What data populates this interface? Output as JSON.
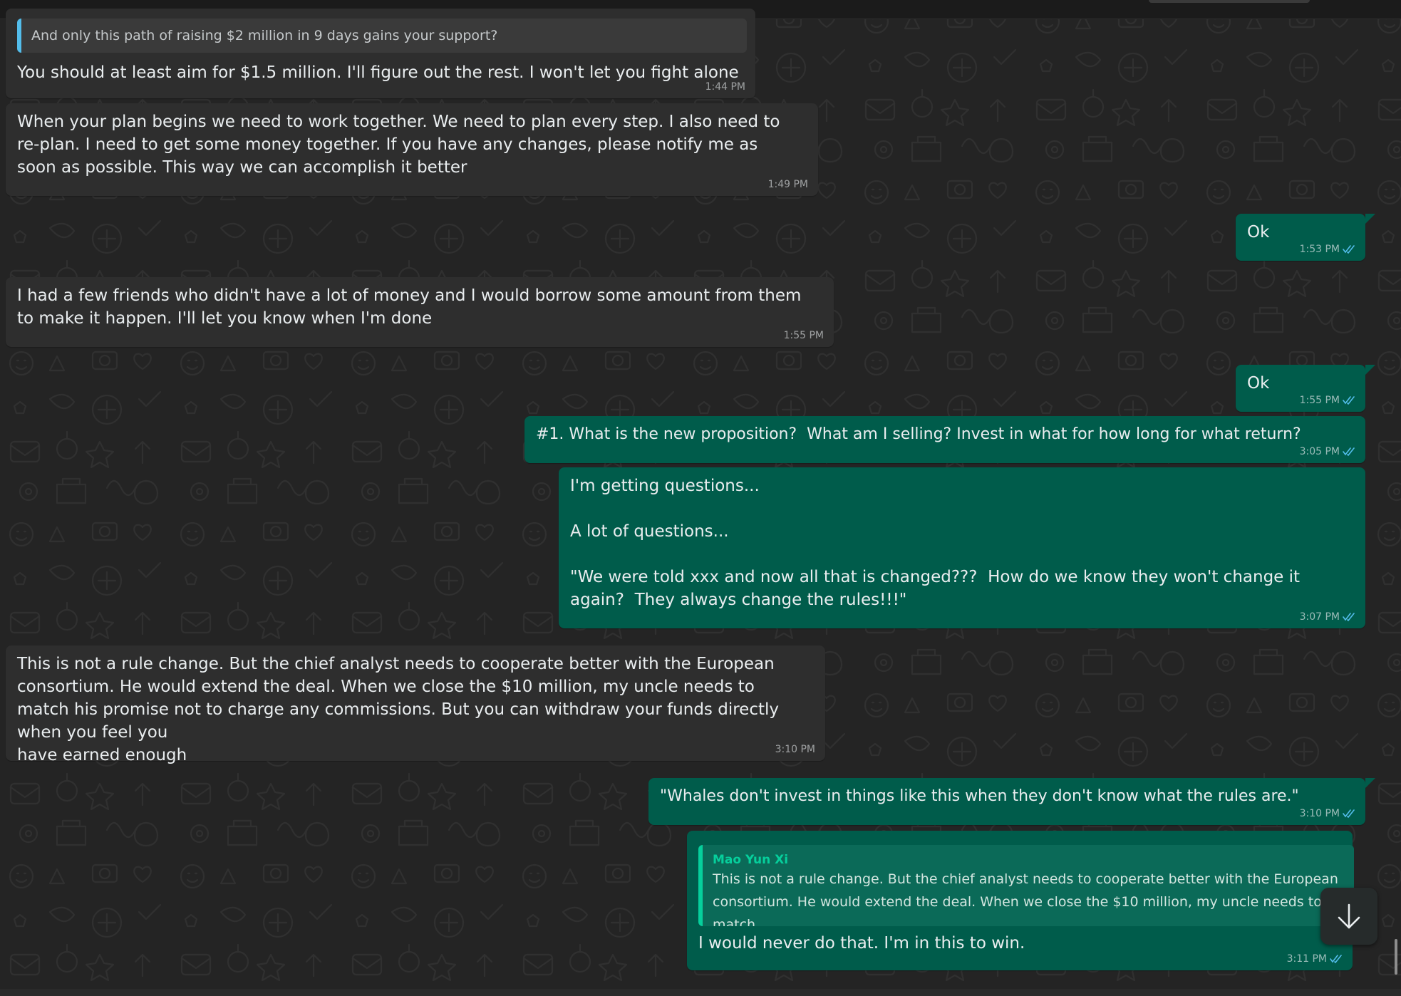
{
  "theme": {
    "incoming_bubble": "#2e2e2e",
    "outgoing_bubble": "#005c4b",
    "read_tick_color": "#53bdeb",
    "quote_author_color": "#06cf9c"
  },
  "messages": [
    {
      "direction": "incoming",
      "quote": {
        "text": "And only this path of raising $2 million in 9 days gains your support?"
      },
      "text": "You should at least aim for $1.5 million. I'll figure out the rest. I won't let you fight alone",
      "time": "1:44 PM"
    },
    {
      "direction": "incoming",
      "text": "When your plan begins we need to work together. We need to plan every step. I also need to re-plan. I need to get some money together. If you have any changes, please notify me as soon as possible. This way we can accomplish it better",
      "time": "1:49 PM"
    },
    {
      "direction": "outgoing",
      "text": "Ok",
      "time": "1:53 PM",
      "status": "read"
    },
    {
      "direction": "incoming",
      "text": "I had a few friends who didn't have a lot of money and I would borrow some amount from them to make it happen. I'll let you know when I'm done",
      "time": "1:55 PM"
    },
    {
      "direction": "outgoing",
      "text": "Ok",
      "time": "1:55 PM",
      "status": "read"
    },
    {
      "direction": "outgoing",
      "text": "#1. What is the new proposition?  What am I selling? Invest in what for how long for what return?",
      "time": "3:05 PM",
      "status": "read"
    },
    {
      "direction": "outgoing",
      "text": "I'm getting questions...\n\nA lot of questions...\n\n\"We were told xxx and now all that is changed???  How do we know they won't change it again?  They always change the rules!!!\"",
      "time": "3:07 PM",
      "status": "read"
    },
    {
      "direction": "incoming",
      "text": "This is not a rule change. But the chief analyst needs to cooperate better with the European consortium. He would extend the deal. When we close the $10 million, my uncle needs to match his promise not to charge any commissions. But you can withdraw your funds directly when you feel you\nhave earned enough",
      "time": "3:10 PM"
    },
    {
      "direction": "outgoing",
      "text": "\"Whales don't invest in things like this when they don't know what the rules are.\"",
      "time": "3:10 PM",
      "status": "read"
    },
    {
      "direction": "outgoing",
      "quote": {
        "author": "Mao Yun Xi",
        "text": "This is not a rule change. But the chief analyst needs to cooperate better with the European consortium. He would extend the deal. When we close the $10 million, my uncle needs to match..."
      },
      "text": "I would never do that. I'm in this to win.",
      "time": "3:11 PM",
      "status": "read"
    }
  ],
  "controls": {
    "scroll_to_bottom_icon": "arrow-down-icon",
    "read_status_icon": "double-check-icon"
  }
}
